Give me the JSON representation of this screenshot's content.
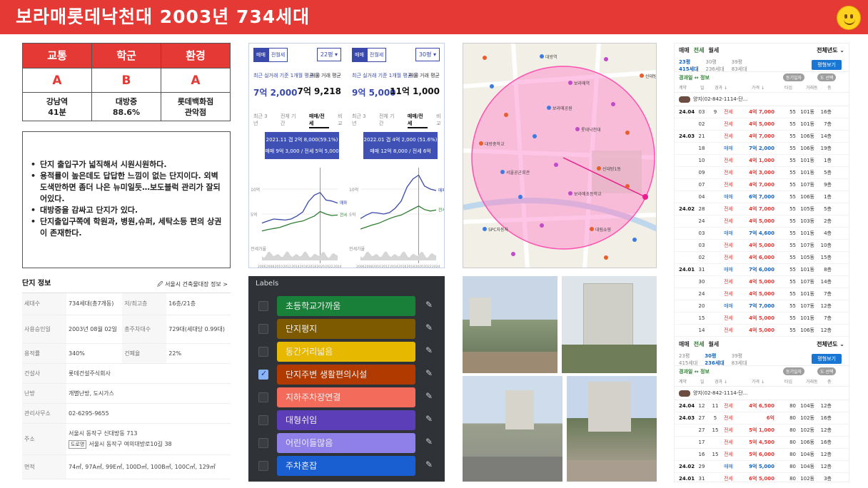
{
  "banner": {
    "title": "보라매롯데낙천대  2003년 734세대"
  },
  "score": {
    "headers": [
      "교통",
      "학군",
      "환경"
    ],
    "grades": [
      "A",
      "B",
      "A"
    ],
    "details": [
      [
        "강남역",
        "41분"
      ],
      [
        "대방중",
        "88.6%"
      ],
      [
        "롯데백화점",
        "관악점"
      ]
    ]
  },
  "notes": [
    "단지 출입구가 넓직해서 시원시원하다.",
    "용적률이 높은데도 답답한 느낌이 없는 단지이다. 외벽도색만하면 좀더 나은 뉴미일듯…보도블럭 관리가 잘되어있다.",
    "대방중을 감싸고 단지가 있다.",
    "단지출입구쪽에 학원과, 병원,슈퍼, 세탁소등 편의 상권이 존재한다."
  ],
  "complex_info": {
    "title": "단지 정보",
    "link": "서울시 건축물대장 정보 >",
    "rows": [
      {
        "k1": "세대수",
        "v1": "734세대(총7개동)",
        "k2": "저/최고층",
        "v2": "16층/21층"
      },
      {
        "k1": "사용승인일",
        "v1": "2003년 08월 02일",
        "k2": "총주차대수",
        "v2": "729대(세대당 0.99대)"
      },
      {
        "k1": "용적률",
        "v1": "340%",
        "k2": "건폐율",
        "v2": "22%"
      },
      {
        "k1": "건설사",
        "v1": "롯데건설주식회사"
      },
      {
        "k1": "난방",
        "v1": "개별난방, 도시가스"
      },
      {
        "k1": "관리사무소",
        "v1": "02-6295-9655"
      },
      {
        "k1": "주소",
        "v1": "서울시 동작구 신대방동 713",
        "tag": "도로명",
        "v1b": "서울시 동작구 여의대방로10길 38"
      },
      {
        "k1": "면적",
        "v1": "74㎡, 97A㎡, 99E㎡, 100D㎡, 100B㎡, 100C㎡, 129㎡"
      }
    ]
  },
  "charts": [
    {
      "tab_on": "매매",
      "tab_off": "전월세",
      "select": "22평 ▾",
      "l1": "최근 실거래 기준 1개월 평균 ⓘ",
      "l2": "매물 거래 평균",
      "v1": "7억 2,000",
      "v2": "7억 9,218",
      "period_tabs": [
        "최근 3년",
        "전체 기간",
        "매매/전세",
        "비교"
      ],
      "tip1": "2021.11 갭 2억 8,000(59.1%)",
      "tip2": "매매 9억 3,000 / 전세 5억 5,000",
      "chart_data": {
        "type": "line",
        "x_ticks": [
          "2006",
          "2008",
          "2010",
          "2012",
          "2014",
          "2016",
          "2018",
          "2020",
          "2022",
          "2024"
        ],
        "y_ticks": [
          "10억",
          "5억"
        ],
        "lower_label": "전세가율",
        "series": [
          {
            "name": "매매",
            "color": "#3949ab",
            "values": [
              3.2,
              3.6,
              4.0,
              3.9,
              3.8,
              4.0,
              4.6,
              5.4,
              7.5,
              8.8,
              9.3,
              7.8,
              7.6,
              7.2
            ]
          },
          {
            "name": "전세",
            "color": "#2e7d32",
            "values": [
              1.6,
              1.9,
              2.1,
              2.3,
              2.7,
              3.1,
              3.4,
              3.6,
              4.1,
              4.6,
              5.5,
              5.0,
              4.7,
              4.8
            ]
          }
        ]
      }
    },
    {
      "tab_on": "매매",
      "tab_off": "전월세",
      "select": "30평 ▾",
      "l1": "최근 실거래 기준 1개월 평균 ⓘ",
      "l2": "매물 거래 평균",
      "v1": "9억 5,000",
      "v2": "11억 1,000",
      "period_tabs": [
        "최근 3년",
        "전체 기간",
        "매매/전세",
        "비교"
      ],
      "tip1": "2022.01 갭 4억 2,000 (51.6%)",
      "tip2": "매매 12억 8,000 / 전세 6억 6,000",
      "chart_data": {
        "type": "line",
        "x_ticks": [
          "2006",
          "2008",
          "2010",
          "2012",
          "2014",
          "2016",
          "2018",
          "2020",
          "2022",
          "2024"
        ],
        "y_ticks": [
          "10억",
          "5억"
        ],
        "lower_label": "전세가율",
        "series": [
          {
            "name": "매매",
            "color": "#3949ab",
            "values": [
              4.1,
              4.8,
              5.3,
              5.2,
              5.0,
              5.3,
              6.2,
              7.6,
              10.4,
              12.0,
              12.8,
              10.6,
              10.0,
              9.7
            ]
          },
          {
            "name": "전세",
            "color": "#2e7d32",
            "values": [
              2.0,
              2.4,
              2.8,
              3.1,
              3.6,
              4.1,
              4.5,
              4.8,
              5.4,
              6.0,
              6.6,
              5.9,
              5.6,
              5.8
            ]
          }
        ]
      }
    }
  ],
  "labels": {
    "title": "Labels",
    "items": [
      {
        "name": "초등학교가까움",
        "color": "#188038",
        "checked": false
      },
      {
        "name": "단지평지",
        "color": "#7d5a00",
        "checked": false
      },
      {
        "name": "동간거리넓음",
        "color": "#e6b800",
        "checked": false
      },
      {
        "name": "단지주변 생활편의시설",
        "color": "#b03a00",
        "checked": true
      },
      {
        "name": "지하주차장연결",
        "color": "#f26b5b",
        "checked": false
      },
      {
        "name": "대형쉬임",
        "color": "#5b3eb8",
        "checked": false
      },
      {
        "name": "어린이들많음",
        "color": "#8f7fe8",
        "checked": false
      },
      {
        "name": "주차혼잡",
        "color": "#1a5fd1",
        "checked": false
      }
    ]
  },
  "tx1": {
    "tabs": [
      "매매",
      "전세",
      "월세"
    ],
    "period": "전체년도 ⌄",
    "sizes": [
      [
        "23평",
        "415세대"
      ],
      [
        "30평",
        "236세대"
      ],
      [
        "39평",
        "83세대"
      ]
    ],
    "map_btn": "평형보기",
    "sort": "경과일 ↔ 정보",
    "pills": [
      "등기일자",
      "도 선택"
    ],
    "cols": [
      "계약",
      "일",
      "경과 ↓",
      "가격 ↓",
      "타입",
      "거래동",
      "층"
    ],
    "agent": "양지(02-842-1114-단...",
    "rows": [
      [
        "24.04",
        "03",
        "9",
        "전세",
        "4억 7,000",
        "55",
        "101동",
        "16층"
      ],
      [
        "",
        "02",
        "",
        "전세",
        "4억 5,000",
        "55",
        "101동",
        "7층"
      ],
      [
        "24.03",
        "21",
        "",
        "전세",
        "4억 7,000",
        "55",
        "106동",
        "14층"
      ],
      [
        "",
        "18",
        "",
        "매매",
        "7억 2,000",
        "55",
        "106동",
        "19층"
      ],
      [
        "",
        "10",
        "",
        "전세",
        "4억 1,000",
        "55",
        "101동",
        "1층"
      ],
      [
        "",
        "09",
        "",
        "전세",
        "4억 3,000",
        "55",
        "101동",
        "5층"
      ],
      [
        "",
        "07",
        "",
        "전세",
        "4억 7,000",
        "55",
        "107동",
        "9층"
      ],
      [
        "",
        "04",
        "",
        "매매",
        "6억 7,000",
        "55",
        "106동",
        "1층"
      ],
      [
        "24.02",
        "28",
        "",
        "전세",
        "4억 7,000",
        "55",
        "105동",
        "5층"
      ],
      [
        "",
        "24",
        "",
        "전세",
        "4억 5,000",
        "55",
        "103동",
        "2층"
      ],
      [
        "",
        "03",
        "",
        "매매",
        "7억 4,600",
        "55",
        "101동",
        "4층"
      ],
      [
        "",
        "03",
        "",
        "전세",
        "4억 5,000",
        "55",
        "107동",
        "10층"
      ],
      [
        "",
        "02",
        "",
        "전세",
        "4억 6,000",
        "55",
        "105동",
        "15층"
      ],
      [
        "24.01",
        "31",
        "",
        "매매",
        "7억 6,000",
        "55",
        "101동",
        "8층"
      ],
      [
        "",
        "30",
        "",
        "전세",
        "4억 5,000",
        "55",
        "107동",
        "14층"
      ],
      [
        "",
        "24",
        "",
        "전세",
        "4억 5,000",
        "55",
        "101동",
        "7층"
      ],
      [
        "",
        "20",
        "",
        "매매",
        "7억 7,000",
        "55",
        "107동",
        "12층"
      ],
      [
        "",
        "15",
        "",
        "전세",
        "4억 5,000",
        "55",
        "101동",
        "7층"
      ],
      [
        "",
        "14",
        "",
        "전세",
        "4억 5,000",
        "55",
        "106동",
        "12층"
      ]
    ]
  },
  "tx2": {
    "tabs": [
      "매매",
      "전세",
      "월세"
    ],
    "period": "전체년도 ⌄",
    "sizes": [
      [
        "23평",
        "415세대"
      ],
      [
        "30평",
        "236세대"
      ],
      [
        "39평",
        "83세대"
      ]
    ],
    "map_btn": "평형보기",
    "sort": "경과일 ↔ 정보",
    "pills": [
      "등기일자",
      "도 선택"
    ],
    "cols": [
      "계약",
      "일",
      "경과 ↓",
      "가격 ↓",
      "타입",
      "거래동",
      "층"
    ],
    "agent": "양지(02-842-1114-단...",
    "rows": [
      [
        "24.04",
        "12",
        "11",
        "전세",
        "4억 6,500",
        "80",
        "104동",
        "12층"
      ],
      [
        "24.03",
        "27",
        "5",
        "전세",
        "6억",
        "80",
        "102동",
        "16층"
      ],
      [
        "",
        "27",
        "15",
        "전세",
        "5억 1,000",
        "80",
        "102동",
        "12층"
      ],
      [
        "",
        "17",
        "",
        "전세",
        "5억 4,500",
        "80",
        "106동",
        "16층"
      ],
      [
        "",
        "16",
        "15",
        "전세",
        "5억 6,000",
        "80",
        "104동",
        "12층"
      ],
      [
        "24.02",
        "29",
        "",
        "매매",
        "9억 5,000",
        "80",
        "104동",
        "12층"
      ],
      [
        "24.01",
        "31",
        "",
        "전세",
        "6억 5,000",
        "80",
        "102동",
        "3층"
      ],
      [
        "",
        "18",
        "",
        "전세",
        "5억 2,900",
        "77",
        "101동",
        "16층"
      ]
    ]
  },
  "map": {
    "labels": [
      "대방역",
      "신대방삼거리역",
      "보라매역",
      "보라매공원",
      "대방중학교",
      "롯데낙천대",
      "서울공군회관",
      "신대방1동",
      "보라매초등학교",
      "SPC자동차",
      "대림쇼핑"
    ]
  },
  "colors": {
    "brand": "#e53935",
    "sale": "#1565c0",
    "rent": "#e53935",
    "chart_blue": "#3949ab",
    "chart_green": "#2e7d32"
  }
}
